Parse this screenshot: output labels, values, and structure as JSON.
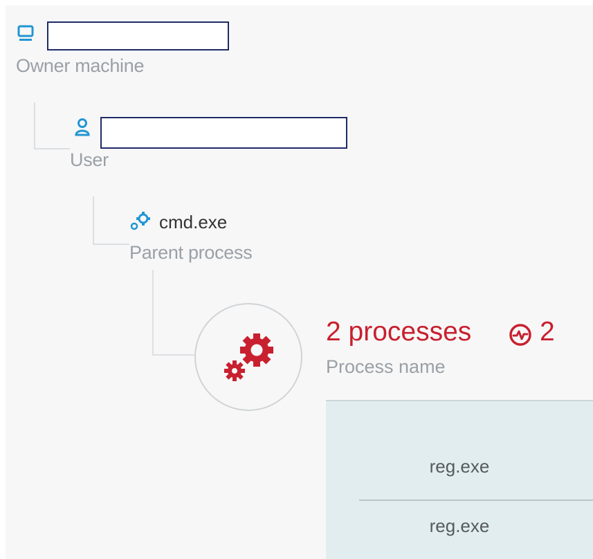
{
  "tree": {
    "owner_machine": {
      "label": "Owner machine",
      "icon": "monitor-icon",
      "icon_color": "#2196d3"
    },
    "user": {
      "label": "User",
      "icon": "user-icon",
      "icon_color": "#2196d3"
    },
    "parent_process": {
      "value": "cmd.exe",
      "label": "Parent process",
      "icon": "small-gears-icon",
      "icon_color": "#2196d3"
    },
    "process": {
      "title": "2 processes",
      "count": "2",
      "label": "Process name",
      "icon": "large-gears-icon",
      "alert_icon": "activity-circle-icon",
      "accent_color": "#c8202f"
    }
  },
  "process_table": {
    "rows": [
      "reg.exe",
      "reg.exe"
    ]
  },
  "colors": {
    "panel_bg": "#f7f7f7",
    "table_bg": "#e2edef",
    "label_gray": "#9aa0a6",
    "tree_line": "#dcdfe2",
    "redaction_border": "#1f2a66"
  }
}
